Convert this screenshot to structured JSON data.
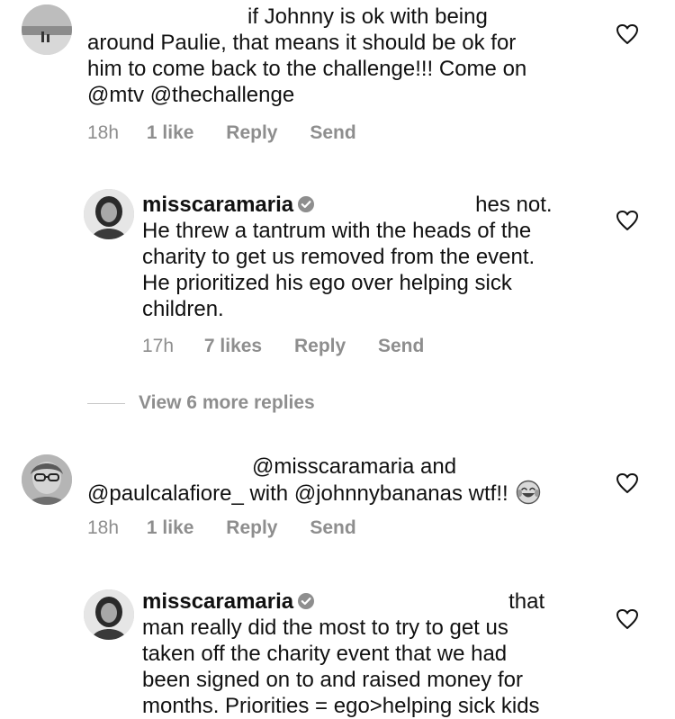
{
  "comments": [
    {
      "username": "",
      "lines": [
        "if Johnny is ok with being",
        "around Paulie, that means it should be ok for",
        "him to come back to the challenge!!! Come on",
        "@mtv @thechallenge"
      ],
      "time": "18h",
      "likes": "1 like",
      "reply": "Reply",
      "send": "Send"
    },
    {
      "username": "misscaramaria",
      "verified": true,
      "first_line_text": "hes not.",
      "lines": [
        "He threw a tantrum with the heads of the",
        "charity to get us removed from the event.",
        "He prioritized his ego over helping sick",
        "children."
      ],
      "time": "17h",
      "likes": "7 likes",
      "reply": "Reply",
      "send": "Send"
    },
    {
      "username": "",
      "lines": [
        "@misscaramaria and",
        "@paulcalafiore_ with @johnnybananas wtf!!"
      ],
      "emoji": "tears-of-joy",
      "time": "18h",
      "likes": "1 like",
      "reply": "Reply",
      "send": "Send"
    },
    {
      "username": "misscaramaria",
      "verified": true,
      "first_line_text": "that",
      "lines": [
        "man really did the most to try to get us",
        "taken off the charity event that we had",
        "been signed on to and raised money for",
        "months. Priorities = ego>helping sick kids"
      ]
    }
  ],
  "view_more_replies": "View 6 more replies",
  "icons": {
    "like": "heart-outline-icon",
    "verified": "verified-badge-icon"
  },
  "colors": {
    "text": "#111111",
    "secondary": "#8e8e8e",
    "rule": "#c7c7c7"
  }
}
